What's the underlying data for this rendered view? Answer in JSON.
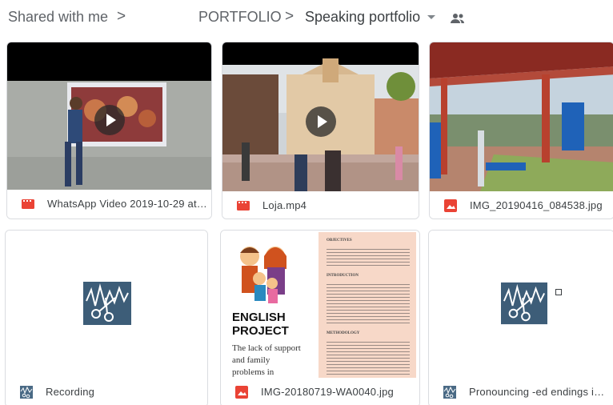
{
  "breadcrumb": {
    "shared": "Shared with me",
    "folder": "PORTFOLIO",
    "current": "Speaking portfolio",
    "separator": ">"
  },
  "files": [
    {
      "name": "WhatsApp Video 2019-10-29 at ...",
      "type": "video",
      "icon": "video-file-icon",
      "icon_color": "#ea4335"
    },
    {
      "name": "Loja.mp4",
      "type": "video",
      "icon": "video-file-icon",
      "icon_color": "#ea4335"
    },
    {
      "name": "IMG_20190416_084538.jpg",
      "type": "image",
      "icon": "image-file-icon",
      "icon_color": "#ea4335"
    },
    {
      "name": "Recording",
      "type": "app",
      "icon": "recording-app-icon",
      "icon_color": "#4a6a85"
    },
    {
      "name": "IMG-20180719-WA0040.jpg",
      "type": "image",
      "icon": "image-file-icon",
      "icon_color": "#ea4335"
    },
    {
      "name": "Pronouncing -ed endings in the r...",
      "type": "app",
      "icon": "recording-app-icon",
      "icon_color": "#4a6a85"
    }
  ],
  "document_preview": {
    "title_line1": "ENGLISH",
    "title_line2": "PROJECT",
    "body_lines": [
      "The lack of support",
      "and family",
      "problems in"
    ],
    "sections": [
      "OBJECTIVES",
      "INTRODUCTION",
      "METHODOLOGY"
    ]
  },
  "colors": {
    "accent_red": "#ea4335",
    "border": "#dadce0",
    "app_icon_bg": "#3d5d78",
    "doc_panel": "#f7d8c8"
  }
}
